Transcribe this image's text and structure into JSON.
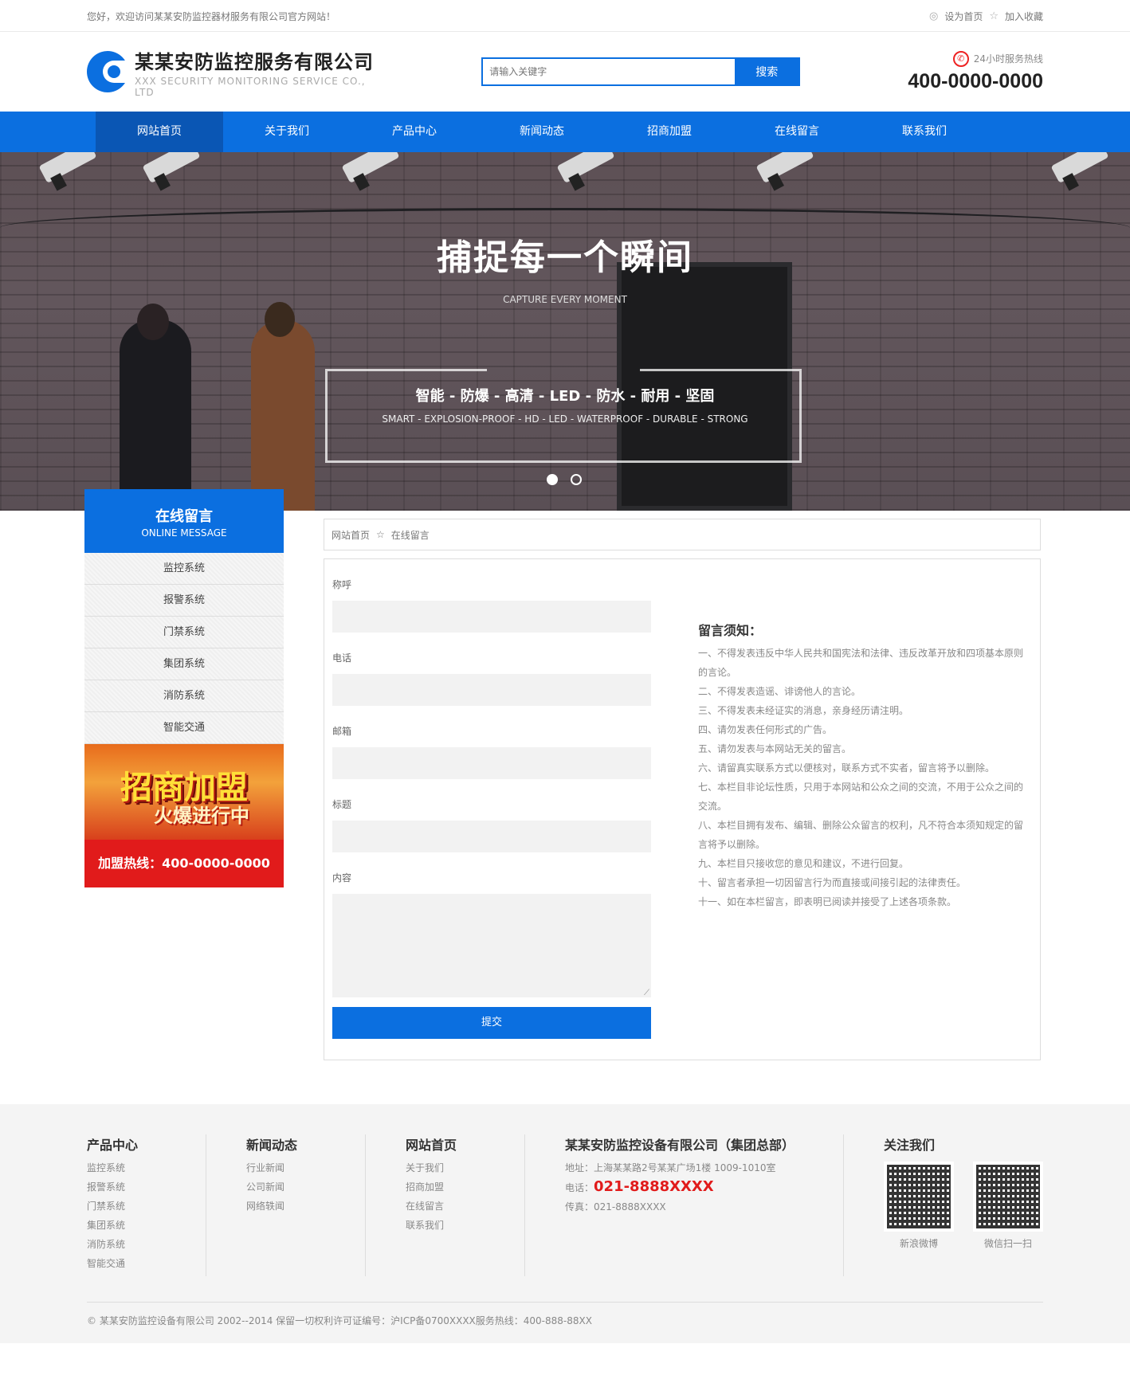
{
  "topbar": {
    "welcome": "您好，欢迎访问某某安防监控器材服务有限公司官方网站！",
    "set_home": "设为首页",
    "favorite": "加入收藏"
  },
  "header": {
    "company_cn": "某某安防监控服务有限公司",
    "company_en": "XXX SECURITY MONITORING SERVICE CO., LTD",
    "search_placeholder": "请输入关键字",
    "search_button": "搜索",
    "hotline_label": "24小时服务热线",
    "hotline_number": "400-0000-0000"
  },
  "nav": [
    "网站首页",
    "关于我们",
    "产品中心",
    "新闻动态",
    "招商加盟",
    "在线留言",
    "联系我们"
  ],
  "banner": {
    "headline": "捕捉每一个瞬间",
    "subtitle_en": "CAPTURE EVERY MOMENT",
    "features_cn": "智能 - 防爆 - 高清 - LED - 防水 - 耐用 - 坚固",
    "features_en": "SMART - EXPLOSION-PROOF - HD - LED - WATERPROOF - DURABLE - STRONG"
  },
  "sidebar": {
    "title_cn": "在线留言",
    "title_en": "ONLINE MESSAGE",
    "items": [
      "监控系统",
      "报警系统",
      "门禁系统",
      "集团系统",
      "消防系统",
      "智能交通"
    ],
    "promo_line1": "招商加盟",
    "promo_line2": "火爆进行中",
    "promo_hotline": "加盟热线：400-0000-0000"
  },
  "breadcrumb": {
    "home": "网站首页",
    "current": "在线留言"
  },
  "form": {
    "name_label": "称呼",
    "phone_label": "电话",
    "email_label": "邮箱",
    "title_label": "标题",
    "content_label": "内容",
    "submit": "提交"
  },
  "notice": {
    "title": "留言须知：",
    "items": [
      "一、不得发表违反中华人民共和国宪法和法律、违反改革开放和四项基本原则的言论。",
      "二、不得发表造谣、诽谤他人的言论。",
      "三、不得发表未经证实的消息，亲身经历请注明。",
      "四、请勿发表任何形式的广告。",
      "五、请勿发表与本网站无关的留言。",
      "六、请留真实联系方式以便核对，联系方式不实者，留言将予以删除。",
      "七、本栏目非论坛性质，只用于本网站和公众之间的交流，不用于公众之间的交流。",
      "八、本栏目拥有发布、编辑、删除公众留言的权利，凡不符合本须知规定的留言将予以删除。",
      "九、本栏目只接收您的意见和建议，不进行回复。",
      "十、留言者承担一切因留言行为而直接或间接引起的法律责任。",
      "十一、如在本栏留言，即表明已阅读并接受了上述各项条款。"
    ]
  },
  "footer": {
    "col1": {
      "title": "产品中心",
      "links": [
        "监控系统",
        "报警系统",
        "门禁系统",
        "集团系统",
        "消防系统",
        "智能交通"
      ]
    },
    "col2": {
      "title": "新闻动态",
      "links": [
        "行业新闻",
        "公司新闻",
        "网络轶闻"
      ]
    },
    "col3": {
      "title": "网站首页",
      "links": [
        "关于我们",
        "招商加盟",
        "在线留言",
        "联系我们"
      ]
    },
    "company": {
      "title": "某某安防监控设备有限公司（集团总部）",
      "address": "地址：上海某某路2号某某广场1楼 1009-1010室",
      "phone_label": "电话：",
      "phone": "021-8888XXXX",
      "fax": "传真：021-8888XXXX"
    },
    "follow": {
      "title": "关注我们",
      "qr1": "新浪微博",
      "qr2": "微信扫一扫"
    },
    "copyright": "© 某某安防监控设备有限公司 2002--2014 保留一切权利许可证编号：沪ICP备0700XXXX服务热线：400-888-88XX"
  }
}
